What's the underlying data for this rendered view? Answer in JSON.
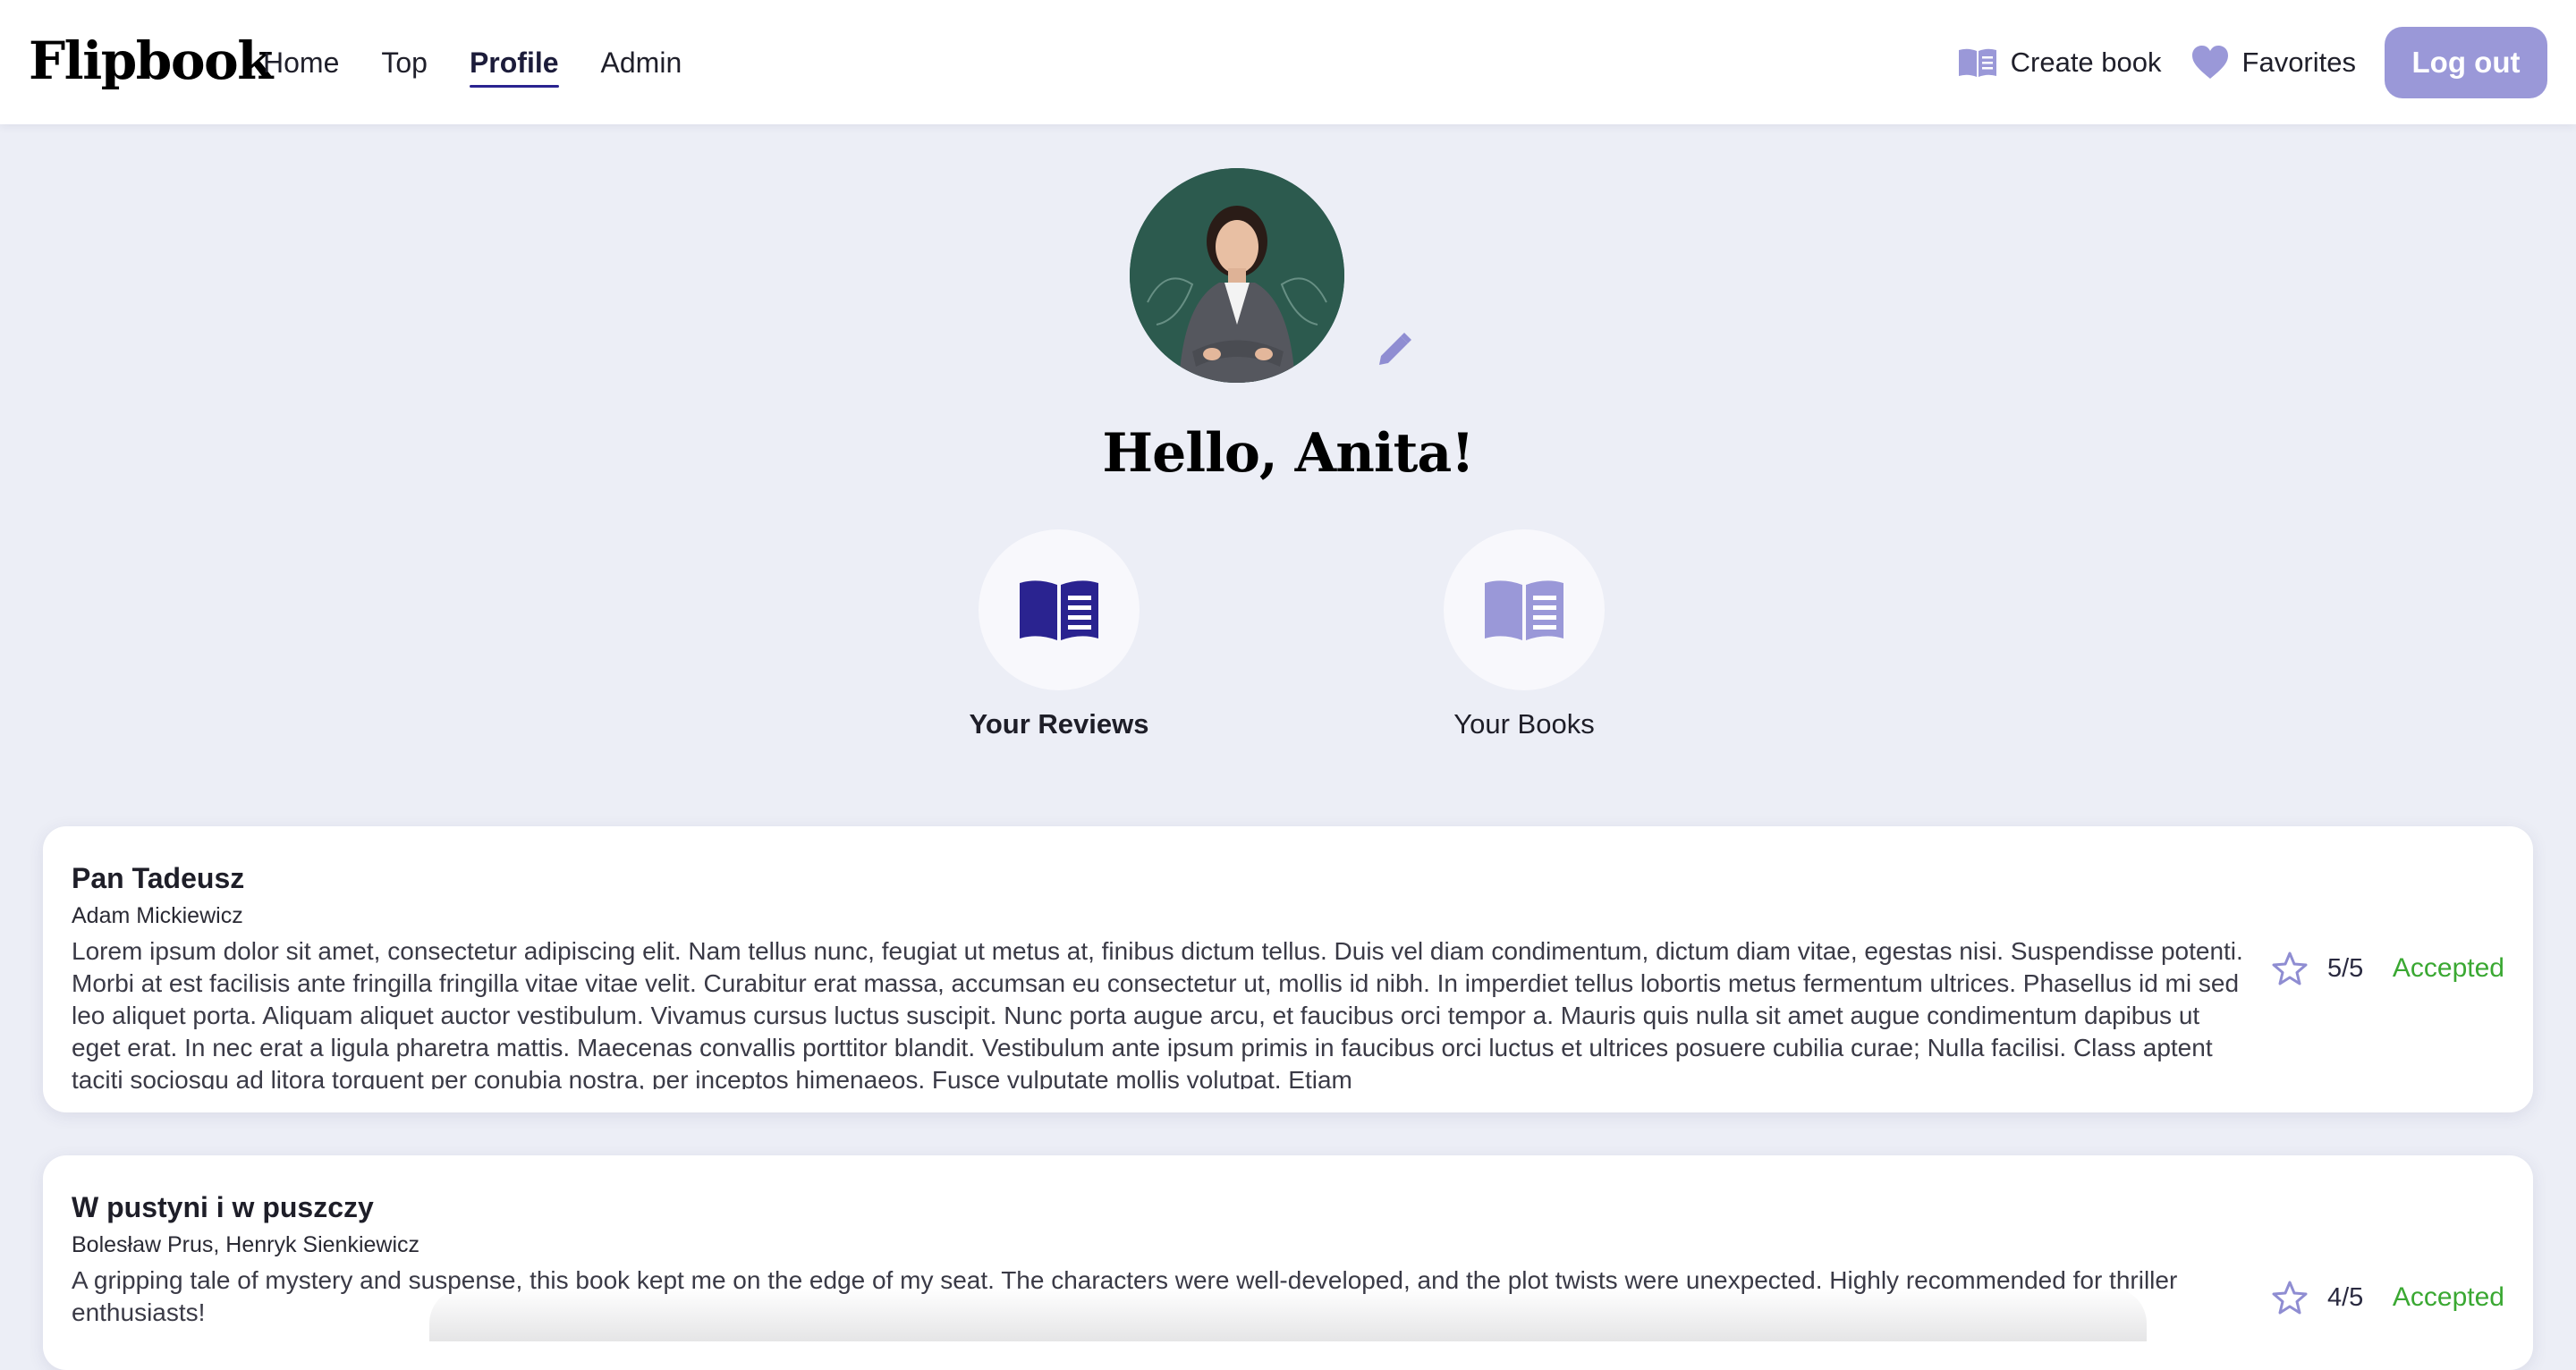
{
  "app": {
    "logo": "Flipbook"
  },
  "nav": {
    "items": [
      {
        "label": "Home"
      },
      {
        "label": "Top"
      },
      {
        "label": "Profile",
        "active": true
      },
      {
        "label": "Admin"
      }
    ]
  },
  "header": {
    "create_book_label": "Create book",
    "create_book_icon": "book-icon",
    "favorites_label": "Favorites",
    "favorites_icon": "heart-icon",
    "logout_label": "Log out"
  },
  "profile": {
    "greeting": "Hello, Anita!",
    "edit_icon": "pencil-icon"
  },
  "tabs": [
    {
      "label": "Your Reviews",
      "icon": "book-icon",
      "active": true
    },
    {
      "label": "Your Books",
      "icon": "book-icon",
      "active": false
    }
  ],
  "reviews": [
    {
      "title": "Pan Tadeusz",
      "author": "Adam Mickiewicz",
      "text": "Lorem ipsum dolor sit amet, consectetur adipiscing elit. Nam tellus nunc, feugiat ut metus at, finibus dictum tellus. Duis vel diam condimentum, dictum diam vitae, egestas nisi. Suspendisse potenti. Morbi at est facilisis ante fringilla fringilla vitae vitae velit. Curabitur erat massa, accumsan eu consectetur ut, mollis id nibh. In imperdiet tellus lobortis metus fermentum ultrices. Phasellus id mi sed leo aliquet porta. Aliquam aliquet auctor vestibulum. Vivamus cursus luctus suscipit. Nunc porta augue arcu, et faucibus orci tempor a. Mauris quis nulla sit amet augue condimentum dapibus ut eget erat. In nec erat a ligula pharetra mattis. Maecenas convallis porttitor blandit. Vestibulum ante ipsum primis in faucibus orci luctus et ultrices posuere cubilia curae; Nulla facilisi. Class aptent taciti sociosqu ad litora torquent per conubia nostra, per inceptos himenaeos. Fusce vulputate mollis volutpat. Etiam",
      "rating": "5/5",
      "status": "Accepted"
    },
    {
      "title": "W pustyni i w puszczy",
      "author": "Bolesław Prus, Henryk Sienkiewicz",
      "text": "A gripping tale of mystery and suspense, this book kept me on the edge of my seat. The characters were well-developed, and the plot twists were unexpected. Highly recommended for thriller enthusiasts!",
      "rating": "4/5",
      "status": "Accepted"
    }
  ],
  "colors": {
    "accent": "#9a98d8",
    "accent_dark": "#2a2390",
    "status_accepted": "#3aa832",
    "background": "#eceef6"
  }
}
